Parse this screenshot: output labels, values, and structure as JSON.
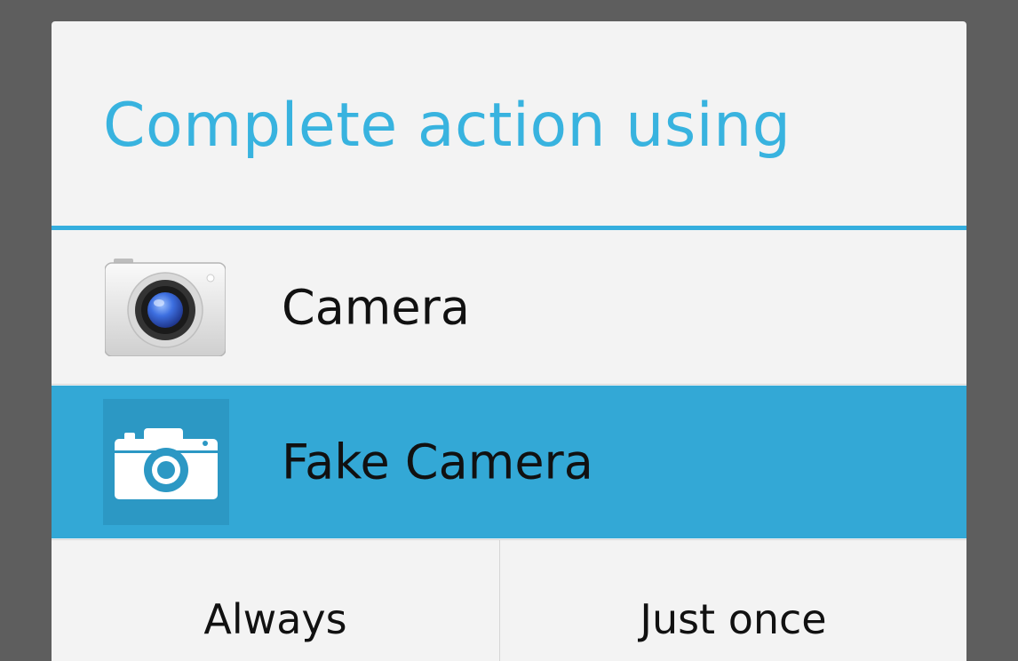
{
  "dialog": {
    "title": "Complete action using",
    "accent_color": "#35aede",
    "selected_row_color": "#33a8d6"
  },
  "apps": [
    {
      "label": "Camera",
      "icon": "camera-app-icon",
      "selected": false
    },
    {
      "label": "Fake Camera",
      "icon": "fake-camera-app-icon",
      "selected": true
    }
  ],
  "buttons": {
    "always": "Always",
    "just_once": "Just once"
  }
}
